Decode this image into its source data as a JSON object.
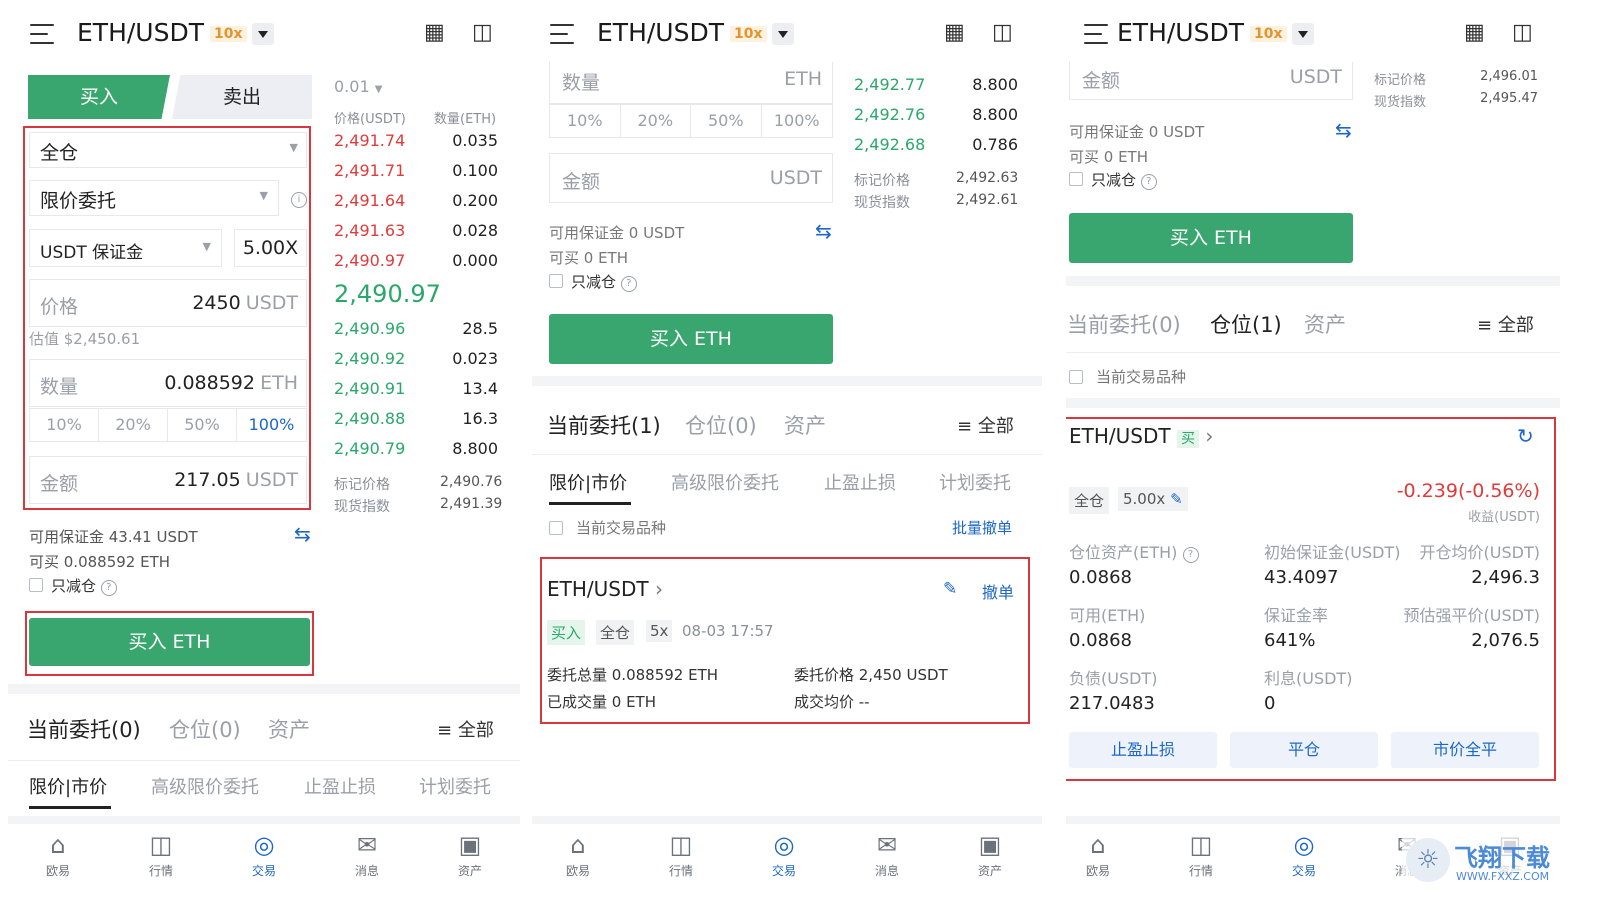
{
  "common": {
    "pair": "ETH/USDT",
    "leverage_badge": "10x",
    "nav": [
      {
        "label": "欧易",
        "icon": "home-icon"
      },
      {
        "label": "行情",
        "icon": "candlestick-icon"
      },
      {
        "label": "交易",
        "icon": "trade-icon"
      },
      {
        "label": "消息",
        "icon": "message-icon"
      },
      {
        "label": "资产",
        "icon": "wallet-icon"
      }
    ]
  },
  "p1": {
    "buy_tab": "买入",
    "sell_tab": "卖出",
    "margin_mode": "全仓",
    "order_type": "限价委托",
    "margin_currency": "USDT 保证金",
    "leverage": "5.00X",
    "price_label": "价格",
    "price_value": "2450",
    "price_unit": "USDT",
    "estimate": "估值 $2,450.61",
    "qty_label": "数量",
    "qty_value": "0.088592",
    "qty_unit": "ETH",
    "pcts": [
      "10%",
      "20%",
      "50%",
      "100%"
    ],
    "amount_label": "金额",
    "amount_value": "217.05",
    "amount_unit": "USDT",
    "available": "可用保证金 43.41 USDT",
    "can_buy": "可买 0.088592 ETH",
    "reduce_only": "只减仓",
    "buy_button": "买入 ETH",
    "orderbook": {
      "precision": "0.01",
      "price_header": "价格(USDT)",
      "qty_header": "数量(ETH)",
      "asks": [
        {
          "p": "2,491.74",
          "q": "0.035"
        },
        {
          "p": "2,491.71",
          "q": "0.100"
        },
        {
          "p": "2,491.64",
          "q": "0.200"
        },
        {
          "p": "2,491.63",
          "q": "0.028"
        },
        {
          "p": "2,490.97",
          "q": "0.000"
        }
      ],
      "last": "2,490.97",
      "bids": [
        {
          "p": "2,490.96",
          "q": "28.5"
        },
        {
          "p": "2,490.92",
          "q": "0.023"
        },
        {
          "p": "2,490.91",
          "q": "13.4"
        },
        {
          "p": "2,490.88",
          "q": "16.3"
        },
        {
          "p": "2,490.79",
          "q": "8.800"
        }
      ],
      "mark_label": "标记价格",
      "mark_value": "2,490.76",
      "index_label": "现货指数",
      "index_value": "2,491.39"
    },
    "tabs": [
      "当前委托(0)",
      "仓位(0)",
      "资产"
    ],
    "all": "全部",
    "subtabs": [
      "限价|市价",
      "高级限价委托",
      "止盈止损",
      "计划委托"
    ]
  },
  "p2": {
    "qty_label": "数量",
    "qty_unit": "ETH",
    "pcts": [
      "10%",
      "20%",
      "50%",
      "100%"
    ],
    "amount_label": "金额",
    "amount_unit": "USDT",
    "available": "可用保证金 0 USDT",
    "can_buy": "可买 0 ETH",
    "reduce_only": "只减仓",
    "buy_button": "买入 ETH",
    "orderbook": {
      "bids": [
        {
          "p": "2,492.77",
          "q": "8.800"
        },
        {
          "p": "2,492.76",
          "q": "8.800"
        },
        {
          "p": "2,492.68",
          "q": "0.786"
        }
      ],
      "mark_label": "标记价格",
      "mark_value": "2,492.63",
      "index_label": "现货指数",
      "index_value": "2,492.61"
    },
    "tabs": [
      "当前委托(1)",
      "仓位(0)",
      "资产"
    ],
    "all": "全部",
    "subtabs": [
      "限价|市价",
      "高级限价委托",
      "止盈止损",
      "计划委托"
    ],
    "current_only": "当前交易品种",
    "batch_cancel": "批量撤单",
    "order": {
      "pair": "ETH/USDT",
      "cancel": "撤单",
      "side": "买入",
      "mode": "全仓",
      "lev": "5x",
      "time": "08-03 17:57",
      "total": "委托总量 0.088592 ETH",
      "price": "委托价格 2,450 USDT",
      "filled": "已成交量 0 ETH",
      "avg": "成交均价 --"
    }
  },
  "p3": {
    "amount_label": "金额",
    "amount_unit": "USDT",
    "mark_label": "标记价格",
    "mark_value": "2,496.01",
    "index_label": "现货指数",
    "index_value": "2,495.47",
    "available": "可用保证金 0 USDT",
    "can_buy": "可买 0 ETH",
    "reduce_only": "只减仓",
    "buy_button": "买入 ETH",
    "tabs": [
      "当前委托(0)",
      "仓位(1)",
      "资产"
    ],
    "all": "全部",
    "current_only": "当前交易品种",
    "position": {
      "pair": "ETH/USDT",
      "side": "买",
      "mode": "全仓",
      "lev": "5.00x",
      "pnl": "-0.239(-0.56%)",
      "pnl_label": "收益(USDT)",
      "c1": "仓位资产(ETH)",
      "c2": "初始保证金(USDT)",
      "c3": "开仓均价(USDT)",
      "v1": "0.0868",
      "v2": "43.4097",
      "v3": "2,496.3",
      "c4": "可用(ETH)",
      "c5": "保证金率",
      "c6": "预估强平价(USDT)",
      "v4": "0.0868",
      "v5": "641%",
      "v6": "2,076.5",
      "c7": "负债(USDT)",
      "c8": "利息(USDT)",
      "v7": "217.0483",
      "v8": "0",
      "btn1": "止盈止损",
      "btn2": "平仓",
      "btn3": "市价全平"
    }
  },
  "watermark": "飞翔下载",
  "watermark_url": "WWW.FXXZ.COM"
}
